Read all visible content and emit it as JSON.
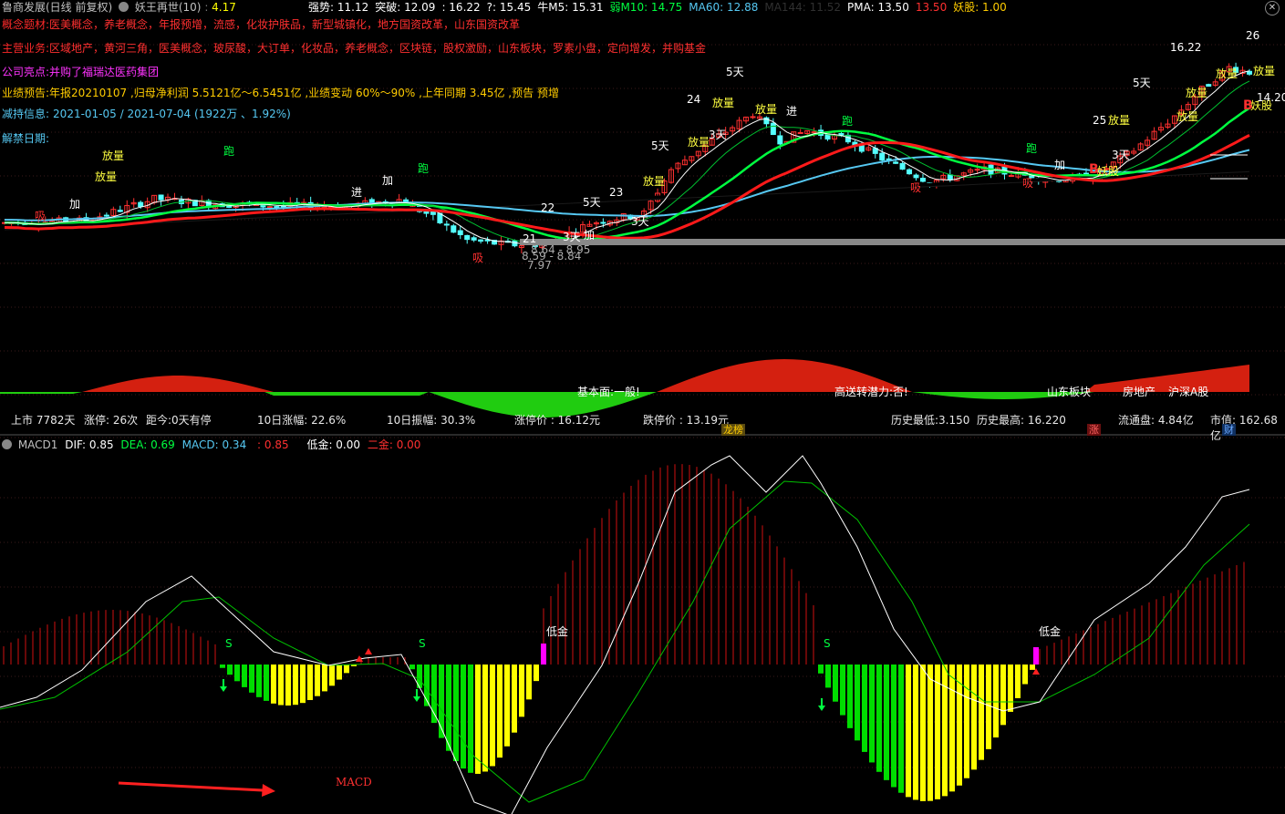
{
  "header": {
    "title": "鲁商发展(日线 前复权)",
    "indicator": "妖王再世(10)",
    "first_value": "4.17",
    "items": [
      {
        "label": "强势:",
        "value": "11.12",
        "color": "#ffffff"
      },
      {
        "label": "突破:",
        "value": "12.09",
        "color": "#ffffff"
      },
      {
        "label": ":",
        "value": "16.22",
        "color": "#ffffff"
      },
      {
        "label": "?:",
        "value": "15.45",
        "color": "#ffffff"
      },
      {
        "label": "牛M5:",
        "value": "15.31",
        "color": "#ffffff"
      },
      {
        "label": "弱M10:",
        "value": "14.75",
        "color": "#00ff40"
      },
      {
        "label": "MA60:",
        "value": "12.88",
        "color": "#56c8f2"
      },
      {
        "label": "MA144:",
        "value": "11.52",
        "color": "#303030"
      },
      {
        "label": "PMA:",
        "value": "13.50",
        "color": "#ffffff"
      },
      {
        "label": "",
        "value": "13.50",
        "color": "#ff3030"
      },
      {
        "label": "妖股:",
        "value": "1.00",
        "color": "#ffcc00"
      }
    ],
    "close_icon": "close-icon"
  },
  "info": {
    "concept_label": "概念题材:",
    "concept_text": "医美概念，养老概念，年报预增，流感，化妆护肤品，新型城镇化，地方国资改革，山东国资改革",
    "business_label": "主营业务:",
    "business_text": "区域地产，黄河三角，医美概念，玻尿酸，大订单，化妆品，养老概念，区块链，股权激励，山东板块，罗素小盘，定向增发，并购基金",
    "highlight_label": "公司亮点:",
    "highlight_text": "并购了福瑞达医药集团",
    "forecast_label": "业绩预告:",
    "forecast_text": "年报20210107 ,归母净利润 5.5121亿～6.5451亿 ,业绩变动 60%～90% ,上年同期 3.45亿 ,预告 预增",
    "reduce_label": "减持信息:",
    "reduce_text": "2021-01-05 / 2021-07-04 (1922万 、1.92%)",
    "unlock_label": "解禁日期:"
  },
  "signals": {
    "fangliang": "放量",
    "pao": "跑",
    "jin": "进",
    "jia": "加",
    "xi": "吸",
    "wu_tian": "5天",
    "san_tian": "3天",
    "yao_gu": "妖股",
    "b": "B",
    "price_high": "16.22",
    "price_low_1": "8.64 - 8.95",
    "price_low_2": "8.59 - 8.84",
    "price_low_3": "7.97",
    "right_low": "14.20",
    "num_26": "26",
    "num_24": "24",
    "num_22": "22",
    "num_23": "23",
    "num_21": "21",
    "num_25": "25",
    "num_21b": "21"
  },
  "fund_band": {
    "jibenmian": "基本面:一般!",
    "gaosong": "高送转潜力:否!",
    "shandong": "山东板块",
    "fangdichan": "房地产",
    "hushen": "沪深A股"
  },
  "stats": {
    "listed": "上市 7782天",
    "limit_up": "涨停: 26次",
    "distance": "距今:0天有停",
    "ten_day_rise": "10日涨幅: 22.6%",
    "ten_day_amp": "10日振幅: 30.3%",
    "limit_up_price": "涨停价 : 16.12元",
    "limit_down_price": "跌停价 : 13.19元",
    "hist_low": "历史最低:3.150",
    "hist_high": "历史最高: 16.220",
    "float_cap": "流通盘: 4.84亿",
    "market_cap": "市值: 162.68亿",
    "tag_longhu": "龙榜",
    "tag_zhang": "涨",
    "tag_cai": "财"
  },
  "macd_header": {
    "name": "MACD1",
    "dif": "DIF: 0.85",
    "dea": "DEA: 0.69",
    "macd": "MACD: 0.34",
    "extra": ": 0.85",
    "low_gold": "低金: 0.00",
    "second_gold": "二金: 0.00"
  },
  "macd_labels": {
    "s": "S",
    "low_gold": "低金",
    "macd_text": "MACD"
  },
  "colors": {
    "up": "#ff3030",
    "down": "#54ffff",
    "ma5": "#ffffff",
    "ma10": "#00ff40",
    "ma60": "#56c8f2",
    "ma144": "#000000",
    "pma": "#ff1a1a",
    "hist_pos": "#d01010",
    "hist_green": "#00dd00",
    "hist_yellow": "#ffff00",
    "hist_mag": "#ff00ff",
    "dif": "#ffffff",
    "dea": "#00c000"
  }
}
